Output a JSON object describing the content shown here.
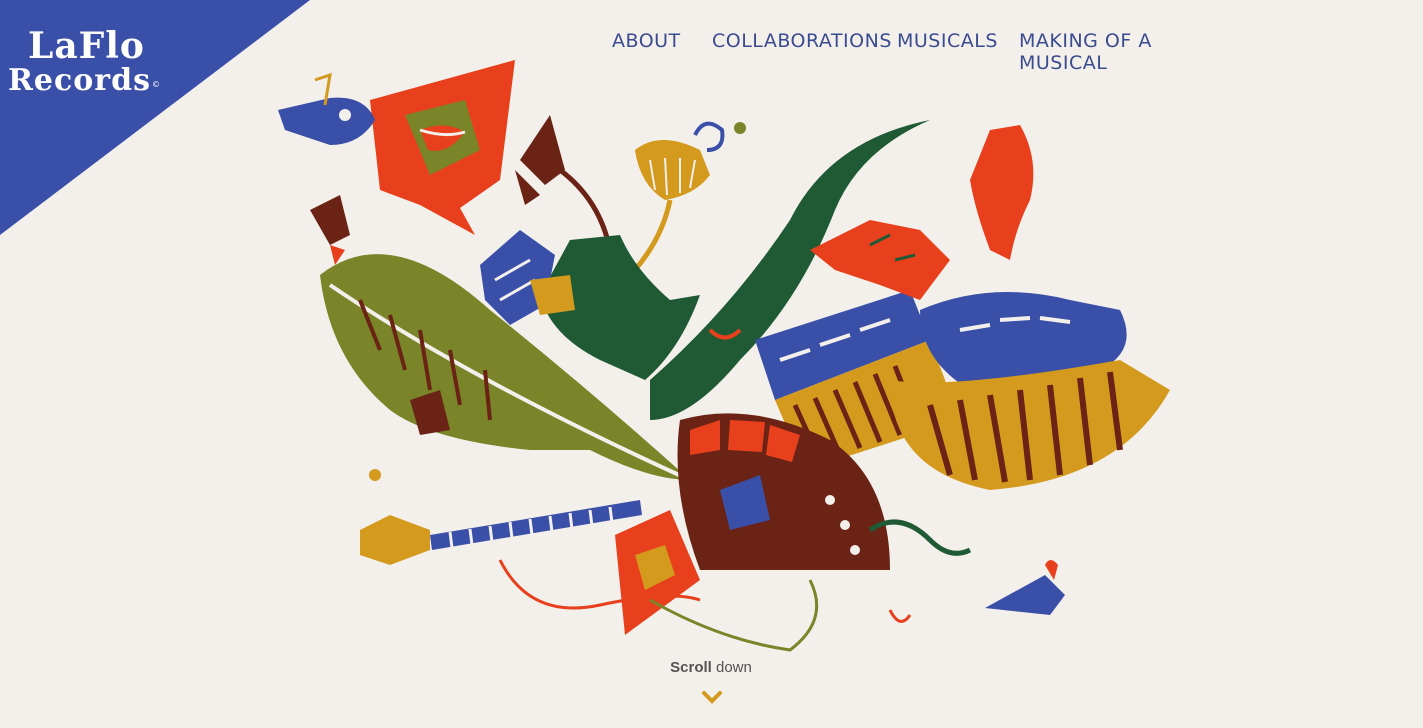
{
  "brand": {
    "logo_line1": "LaFlo",
    "logo_line2": "Records",
    "logo_mark": "©",
    "corner_color": "#3a4fa8"
  },
  "nav": {
    "about": "ABOUT",
    "collaborations": "COLLABORATIONS",
    "musicals": "MUSICALS",
    "making": "MAKING OF A MUSICAL"
  },
  "scroll": {
    "bold": "Scroll",
    "rest": " down",
    "icon": "chevron-down-icon"
  },
  "palette": {
    "background": "#f3f0ec",
    "blue": "#3a4fa8",
    "red": "#e8401c",
    "olive": "#7a8428",
    "green": "#1f5a34",
    "mustard": "#d49a1e",
    "brown": "#6a2314"
  }
}
